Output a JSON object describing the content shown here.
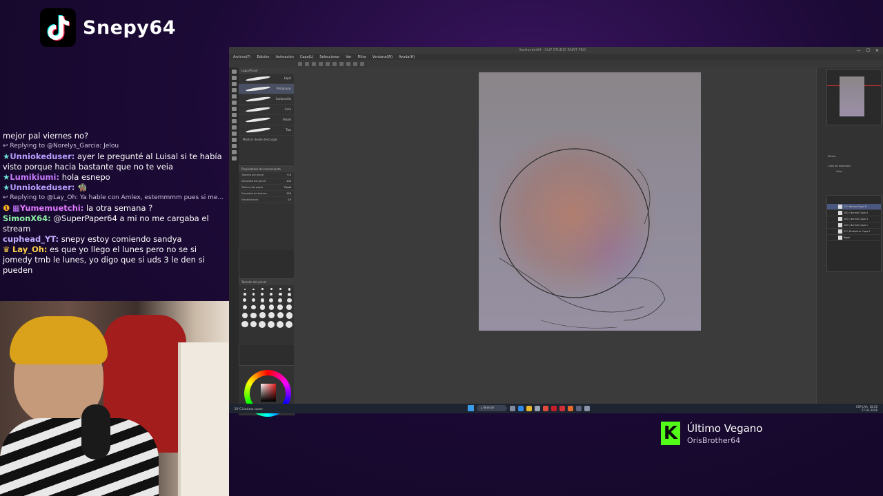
{
  "brand": {
    "name": "Snepy64",
    "icon": "tiktok-icon"
  },
  "chat": [
    {
      "type": "msg",
      "user": "",
      "text": "mejor pal viernes no?"
    },
    {
      "type": "reply",
      "text": "Replying to @Norelys_Garcia: Jelou"
    },
    {
      "type": "msg",
      "badge": "star",
      "user": "Unniokeduser:",
      "color": "#b6a0ff",
      "text": "ayer le pregunté al Luisal si te había visto porque hacia bastante que no te veia"
    },
    {
      "type": "msg",
      "badge": "star",
      "user": "Lumikiumi:",
      "color": "#c87cff",
      "text": "hola esnepo"
    },
    {
      "type": "msg",
      "badge": "star",
      "user": "Unniokeduser:",
      "color": "#b6a0ff",
      "text": "🧌"
    },
    {
      "type": "reply",
      "text": "Replying to @Lay_Oh: Ya hable con Amlex, estemmmm pues si me..."
    },
    {
      "type": "msg",
      "badge": "sub",
      "user": "Yumemuetchi:",
      "color": "#e07bff",
      "text": "la otra semana ?"
    },
    {
      "type": "msg",
      "user": "SimonX64:",
      "color": "#8cf2a7",
      "text": "@SuperPaper64 a mi no me cargaba el stream"
    },
    {
      "type": "msg",
      "user": "cuphead_YT:",
      "color": "#c0b0ff",
      "text": "snepy estoy comiendo sandya"
    },
    {
      "type": "msg",
      "badge": "crown",
      "user": "Lay_Oh:",
      "color": "#ffd24a",
      "text": "es que yo llego el lunes pero no se si jomedy tmb le lunes, yo digo que si uds 3 le den si pueden"
    }
  ],
  "app": {
    "title": "Ilustración64 - CLIP STUDIO PAINT PRO",
    "menu": [
      "Archivo(F)",
      "Edición",
      "Animación",
      "Capa(L)",
      "Seleccionar",
      "Ver",
      "Filtro",
      "Ventana(W)",
      "Ayuda(H)"
    ],
    "brush_panel_title": "Lápiz/Pincel",
    "brushes": [
      {
        "label": "Lápiz",
        "selected": false
      },
      {
        "label": "Pintaceras",
        "selected": true
      },
      {
        "label": "Carboncillo",
        "selected": false
      },
      {
        "label": "Cera",
        "selected": false
      },
      {
        "label": "Pastel",
        "selected": false
      },
      {
        "label": "Tiza",
        "selected": false
      }
    ],
    "brush_footer": "Mostrar desde descargas",
    "prop_panel_title": "Propiedades de herramienta",
    "props": [
      {
        "label": "Tamaño del pincel",
        "value": "9.0"
      },
      {
        "label": "Densidad del pincel",
        "value": "100"
      },
      {
        "label": "Textura del papel",
        "value": "Papel"
      },
      {
        "label": "Densidad de textura",
        "value": "100"
      },
      {
        "label": "Estabilización",
        "value": "10"
      }
    ],
    "size_panel_title": "Tamaño del pincel",
    "nav_title": "Navegador",
    "layer_panel_title": "Capa",
    "right_labels": [
      "Efecto",
      "Color de expresión",
      "Color"
    ],
    "layers": [
      {
        "name": "23 \\ Normal  Capa 6",
        "selected": true
      },
      {
        "name": "100 \\ Normal  Capa 4",
        "selected": false
      },
      {
        "name": "100 \\ Normal  Capa 3",
        "selected": false
      },
      {
        "name": "100 \\ Normal  Capa 1",
        "selected": false
      },
      {
        "name": "23 \\ Multiplicar  Capa 2",
        "selected": false
      },
      {
        "name": "Papel",
        "selected": false
      }
    ]
  },
  "taskbar": {
    "weather": "20°C  Llovizna suave",
    "search": "Buscar",
    "lang": "ESP LAA",
    "time": "18:26",
    "date": "27-02-2026"
  },
  "now_playing": {
    "icon": "kick-icon",
    "title": "Último Vegano",
    "artist": "OrisBrother64"
  }
}
